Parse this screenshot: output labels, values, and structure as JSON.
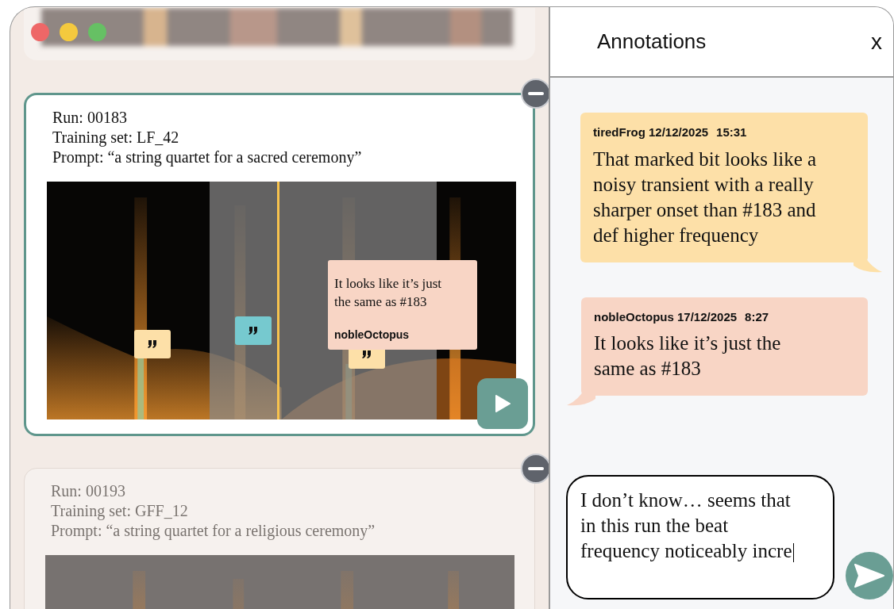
{
  "window": {
    "controls": [
      {
        "color": "#ee6767"
      },
      {
        "color": "#f4c93e"
      },
      {
        "color": "#66c064"
      }
    ]
  },
  "runs": [
    {
      "run": "Run: 00183",
      "training_set": "Training set: LF_42",
      "prompt": "Prompt:  “a string quartet for a sacred ceremony”",
      "selected": true,
      "markers": [
        {
          "color": "#fde0a8"
        },
        {
          "color": "#76c9cf"
        },
        {
          "color": "#fde0a8"
        }
      ],
      "popup": {
        "text": "It looks like it’s just the same as #183",
        "author": "nobleOctopus"
      }
    },
    {
      "run": "Run: 00193",
      "training_set": "Training set: GFF_12",
      "prompt": "Prompt:  “a string quartet for a religious ceremony”",
      "selected": false
    }
  ],
  "annotations": {
    "title": "Annotations",
    "close": "x",
    "comments": [
      {
        "author": "tiredFrog",
        "date": "12/12/2025",
        "time": "15:31",
        "text": "That marked bit looks like a noisy transient with a really sharper onset than #183 and def higher frequency",
        "color": "#fde0a8"
      },
      {
        "author": "nobleOctopus",
        "date": "17/12/2025",
        "time": "8:27",
        "text": "It looks like it’s just the same as #183",
        "color": "#f8d5c5"
      }
    ],
    "composer": {
      "value": "I don’t know… seems that in this run the beat frequency noticeably incre"
    }
  }
}
